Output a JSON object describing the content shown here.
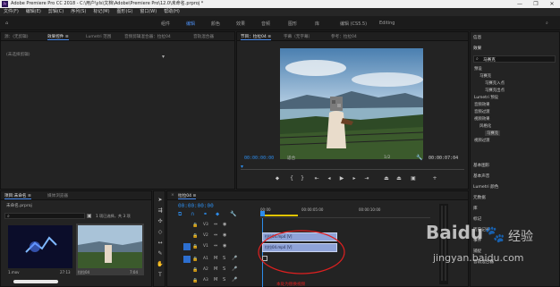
{
  "window": {
    "title": "Adobe Premiere Pro CC 2018 - C:\\用户\\yls\\文档\\Adobe\\Premiere Pro\\12.0\\未命名.prproj *",
    "app_icon": "Pr",
    "controls": [
      "—",
      "❐",
      "✕"
    ]
  },
  "menu": [
    "文件(F)",
    "编辑(E)",
    "剪辑(C)",
    "序列(S)",
    "标记(M)",
    "图形(G)",
    "窗口(W)",
    "帮助(H)"
  ],
  "workspaces": [
    "组件",
    "编辑",
    "颜色",
    "效果",
    "音频",
    "图形",
    "库",
    "编辑 (CS5.5)",
    "Editing"
  ],
  "source_panel": {
    "tabs": [
      "源：(无剪辑)",
      "效果控件 ≡",
      "Lumetri 范围",
      "音频剪辑混合器：拉拉04",
      "音轨混合器"
    ],
    "no_clip": "(未选择剪辑)"
  },
  "program_panel": {
    "tabs": [
      "节目：拉拉04 ≡",
      "字幕（无字幕）",
      "参考：拉拉04"
    ],
    "timecode": "00:00:00:00",
    "fit": "适合",
    "quality": "1/2",
    "duration": "00:00:07:04"
  },
  "right_panel": {
    "header": "信息",
    "subheader": "效果",
    "search_value": "马赛克",
    "tree": [
      "预设",
      "马赛克",
      "马赛克入点",
      "马赛克出点",
      "Lumetri 预设",
      "音频效果",
      "音频过渡",
      "视频效果",
      "风格化",
      "马赛克",
      "视频过渡"
    ],
    "items": [
      "基本图形",
      "基本声音",
      "Lumetri 颜色",
      "元数据",
      "库",
      "标记",
      "历史记录",
      "事件",
      "捕捉",
      "音轨混合器"
    ]
  },
  "project_panel": {
    "tabs": [
      "项目:未命名 ≡",
      "媒体浏览器"
    ],
    "file": "未命名.prproj",
    "selected_info": "1 项已选择，共 3 项",
    "clip1_name": "1.mov",
    "clip1_dur": "27:13",
    "clip2_name": "拉拉04",
    "clip2_dur": "7:04"
  },
  "timeline": {
    "tab": "拉拉04 ≡",
    "timecode": "00:00:00:00",
    "ruler": [
      "00:00",
      "00:00:05:00",
      "00:00:10:00"
    ],
    "video_tracks": [
      "V3",
      "V2",
      "V1"
    ],
    "audio_tracks": [
      "A1",
      "A2",
      "A3"
    ],
    "clip_v2": "拉拉04.mp4 [V]",
    "clip_v1": "拉拉04.mp4 [V]",
    "annotation": "本处为替换视频"
  },
  "watermark": {
    "brand": "Baidu",
    "sub": "经验",
    "url": "jingyan.baidu.com"
  },
  "colors": {
    "accent": "#2d8ceb",
    "annotation": "#e02020",
    "clip": "#8fa3d8"
  }
}
